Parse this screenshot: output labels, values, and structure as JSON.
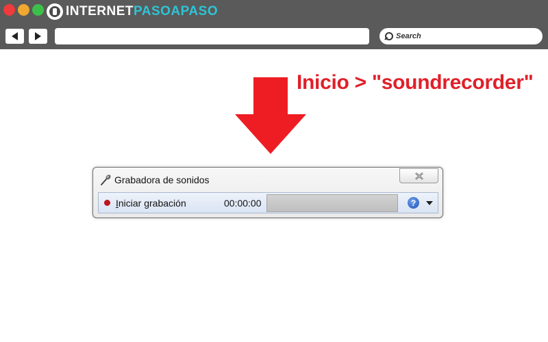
{
  "browser": {
    "logo_prefix": "INTERNET",
    "logo_accent": "PASOAPASO",
    "url": "",
    "search_placeholder": "Search",
    "icons": [
      "close-dot",
      "minimize-dot",
      "maximize-dot",
      "back-arrow-icon",
      "forward-arrow-icon",
      "search-icon"
    ]
  },
  "annotation": {
    "text": "Inicio > \"soundrecorder\"",
    "color": "#e0202a"
  },
  "recorder": {
    "title": "Grabadora de sonidos",
    "record_label_underlined": "I",
    "record_label_rest": "niciar grabación",
    "time": "00:00:00",
    "close_glyph": "✕",
    "help_glyph": "?",
    "level_fraction": 0
  }
}
